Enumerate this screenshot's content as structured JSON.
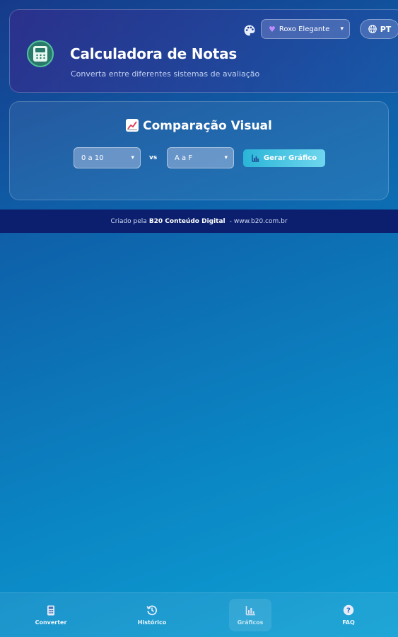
{
  "header": {
    "title": "Calculadora de Notas",
    "subtitle": "Converta entre diferentes sistemas de avaliação",
    "theme_select": {
      "selected": "Roxo Elegante"
    },
    "language_button": "PT",
    "icons": [
      "palette-icon",
      "heart-icon",
      "chevron-down-icon",
      "globe-icon",
      "calculator-logo"
    ]
  },
  "comparison": {
    "title": "Comparação Visual",
    "title_icon": "chart-emoji",
    "from_scale": {
      "selected": "0 a 10"
    },
    "vs_label": "vs",
    "to_scale": {
      "selected": "A a F"
    },
    "generate_button": "Gerar Gráfico"
  },
  "footer": {
    "prefix": "Criado pela",
    "brand": "B20 Conteúdo Digital",
    "separator": "-",
    "site": "www.b20.com.br"
  },
  "bottom_nav": {
    "items": [
      {
        "label": "Converter",
        "icon": "calculator-icon"
      },
      {
        "label": "Histórico",
        "icon": "history-icon"
      },
      {
        "label": "Gráficos",
        "icon": "bar-chart-icon"
      },
      {
        "label": "FAQ",
        "icon": "help-circle-icon"
      }
    ],
    "active": "Gráficos"
  },
  "colors": {
    "background_top": "#163a8a",
    "background_bottom": "#0fa0d4",
    "button_accent": "#2bb5d8",
    "footer_strip": "#0b1f6e",
    "logo_green": "#4fc39b"
  }
}
